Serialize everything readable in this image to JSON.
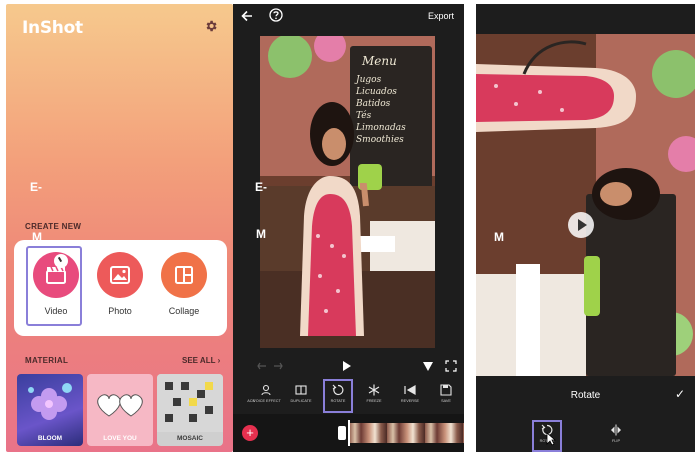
{
  "home": {
    "logo": "InShot",
    "overlay_e": "E-",
    "overlay_m": "M",
    "create_new_label": "CREATE NEW",
    "create_items": [
      {
        "label": "Video",
        "icon": "clapperboard-icon",
        "color": "#e84b7d"
      },
      {
        "label": "Photo",
        "icon": "image-icon",
        "color": "#ed5a5a"
      },
      {
        "label": "Collage",
        "icon": "collage-icon",
        "color": "#f07248"
      }
    ],
    "material_label": "MATERIAL",
    "see_all": "SEE ALL",
    "materials": [
      {
        "label": "BLOOM"
      },
      {
        "label": "LOVE YOU"
      },
      {
        "label": "MOSAIC"
      }
    ]
  },
  "editor": {
    "export_label": "Export",
    "overlay_e": "E-",
    "overlay_m": "M",
    "board_text": [
      "Menu",
      "Jugos",
      "Licuados",
      "Batidos",
      "Tés",
      "Limonadas",
      "Smoothies"
    ],
    "tools": [
      {
        "label": "VOICE EFFECT",
        "icon": "voice-effect-icon"
      },
      {
        "label": "DUPLICATE",
        "icon": "duplicate-icon"
      },
      {
        "label": "ROTATE",
        "icon": "rotate-icon"
      },
      {
        "label": "FREEZE",
        "icon": "freeze-icon"
      },
      {
        "label": "REVERSE",
        "icon": "reverse-icon"
      },
      {
        "label": "SAVE",
        "icon": "save-icon"
      }
    ]
  },
  "rotate_screen": {
    "overlay_m": "M",
    "title": "Rotate",
    "tools": [
      {
        "label": "ROTATE",
        "icon": "rotate-icon"
      },
      {
        "label": "FLIP",
        "icon": "flip-icon"
      }
    ]
  },
  "colors": {
    "accent_highlight": "#8a7fd9",
    "add_button": "#e6304f",
    "editor_bg": "#1d1d1d"
  }
}
